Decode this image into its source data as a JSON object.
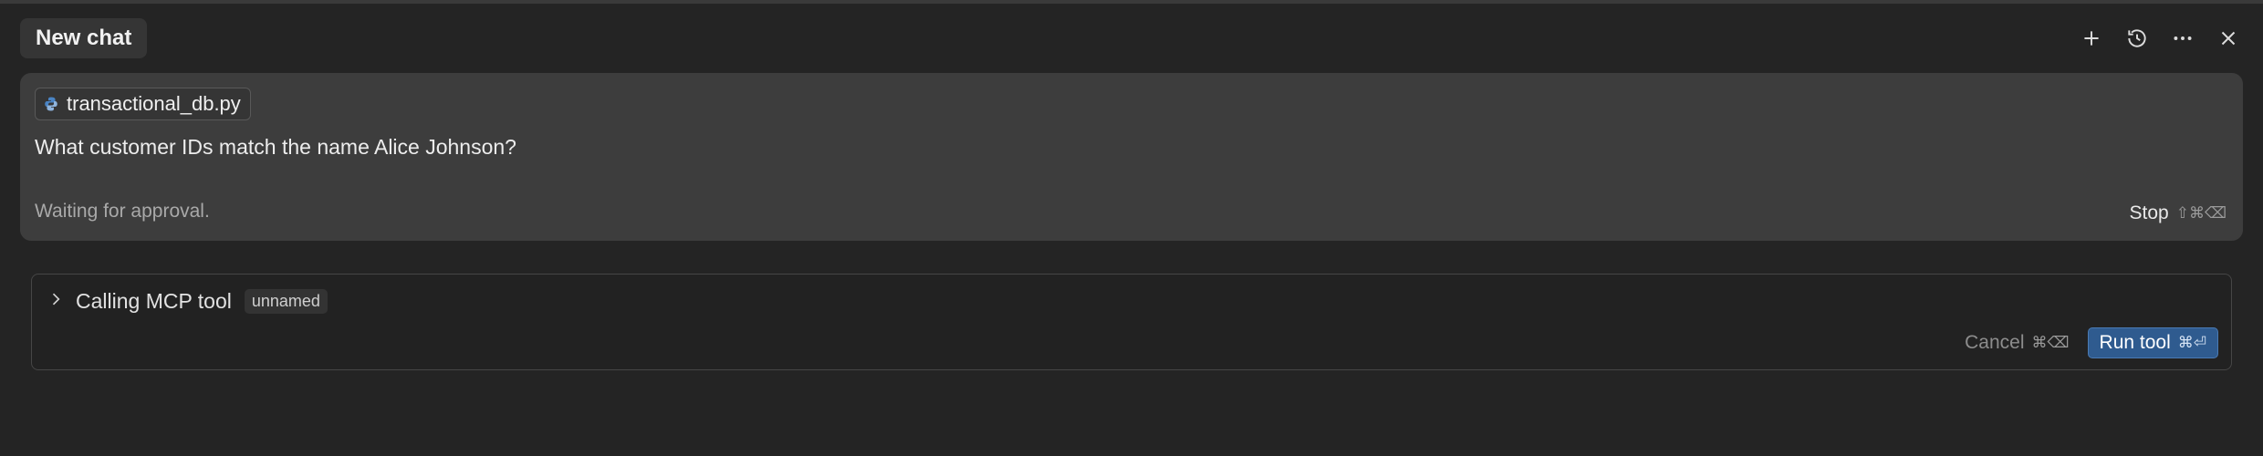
{
  "header": {
    "chat_title": "New chat",
    "actions": [
      {
        "name": "plus-icon"
      },
      {
        "name": "history-icon"
      },
      {
        "name": "more-icon"
      },
      {
        "name": "close-icon"
      }
    ]
  },
  "message": {
    "file_chip": "transactional_db.py",
    "file_icon": "python-icon",
    "prompt": "What customer IDs match the name Alice Johnson?",
    "status": "Waiting for approval.",
    "stop_label": "Stop",
    "stop_shortcut": "⇧⌘⌫"
  },
  "tool": {
    "title": "Calling MCP tool",
    "tag": "unnamed",
    "cancel_label": "Cancel",
    "cancel_shortcut": "⌘⌫",
    "run_label": "Run tool",
    "run_shortcut": "⌘⏎"
  },
  "colors": {
    "background": "#242424",
    "card": "#3d3d3d",
    "accent": "#2f5b8f"
  }
}
